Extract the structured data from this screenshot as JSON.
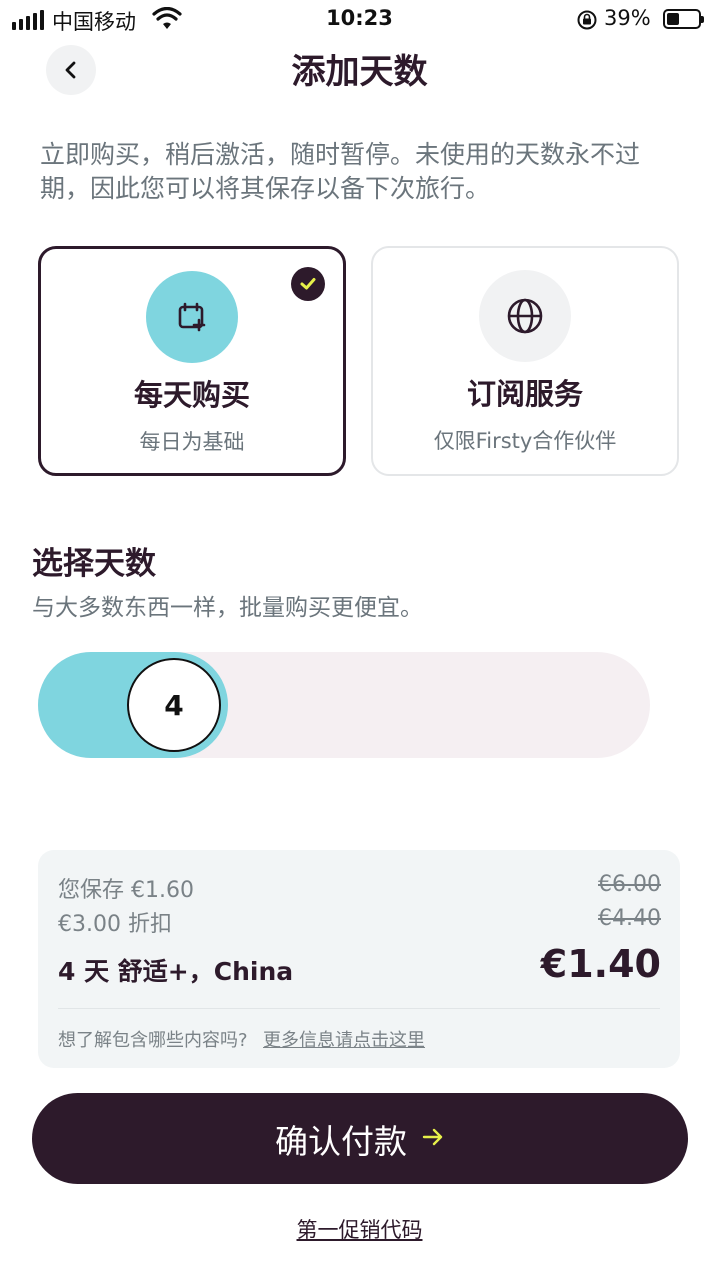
{
  "status_bar": {
    "carrier": "中国移动",
    "time": "10:23",
    "battery": "39%",
    "battery_level": 0.39
  },
  "header": {
    "back_icon": "chevron-left-icon",
    "title": "添加天数"
  },
  "intro": "立即购买，稍后激活，随时暂停。未使用的天数永不过期，因此您可以将其保存以备下次旅行。",
  "options": [
    {
      "name": "每天购买",
      "subtitle": "每日为基础",
      "icon": "calendar-plus-icon",
      "selected": true
    },
    {
      "name": "订阅服务",
      "subtitle": "仅限Firsty合作伙伴",
      "icon": "globe-icon",
      "selected": false
    }
  ],
  "days_section": {
    "title": "选择天数",
    "subtitle": "与大多数东西一样，批量购买更便宜。",
    "value": "4"
  },
  "summary": {
    "savings": "您保存 €1.60",
    "discount": "€3.00 折扣",
    "old_price_1": "€6.00",
    "old_price_2": "€4.40",
    "plan": "4 天 舒适+，China",
    "price": "€1.40",
    "question": "想了解包含哪些内容吗?",
    "more_info_link": "更多信息请点击这里"
  },
  "confirm": {
    "label": "确认付款",
    "arrow": "→"
  },
  "promo_link": "第一促销代码",
  "colors": {
    "primary": "#2d1a2b",
    "accent": "#7fd5df",
    "check": "#e6f04a",
    "muted": "#6b757c"
  }
}
